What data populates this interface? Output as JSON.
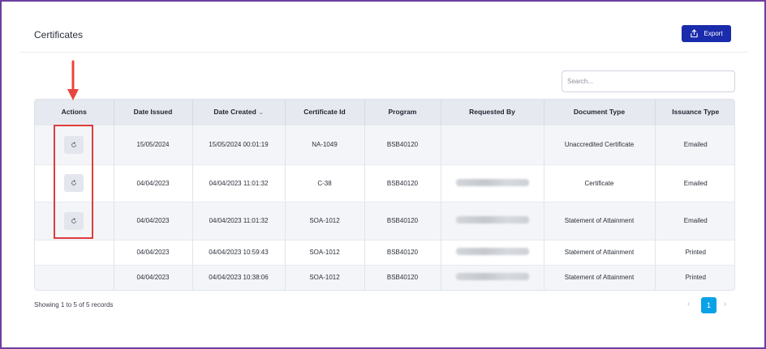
{
  "page": {
    "title": "Certificates",
    "export_label": "Export",
    "search_placeholder": "Search..."
  },
  "table": {
    "columns": [
      "Actions",
      "Date Issued",
      "Date Created",
      "Certificate Id",
      "Program",
      "Requested By",
      "Document Type",
      "Issuance Type"
    ],
    "rows": [
      {
        "date_issued": "15/05/2024",
        "date_created": "15/05/2024 00:01:19",
        "certificate_id": "NA-1049",
        "program": "BSB40120",
        "requested_by": "",
        "document_type": "Unaccredited Certificate",
        "issuance_type": "Emailed"
      },
      {
        "date_issued": "04/04/2023",
        "date_created": "04/04/2023 11:01:32",
        "certificate_id": "C-38",
        "program": "BSB40120",
        "requested_by": "",
        "document_type": "Certificate",
        "issuance_type": "Emailed"
      },
      {
        "date_issued": "04/04/2023",
        "date_created": "04/04/2023 11:01:32",
        "certificate_id": "SOA-1012",
        "program": "BSB40120",
        "requested_by": "",
        "document_type": "Statement of Attainment",
        "issuance_type": "Emailed"
      },
      {
        "date_issued": "04/04/2023",
        "date_created": "04/04/2023 10:59:43",
        "certificate_id": "SOA-1012",
        "program": "BSB40120",
        "requested_by": "",
        "document_type": "Statement of Attainment",
        "issuance_type": "Printed"
      },
      {
        "date_issued": "04/04/2023",
        "date_created": "04/04/2023 10:38:06",
        "certificate_id": "SOA-1012",
        "program": "BSB40120",
        "requested_by": "",
        "document_type": "Statement of Attainment",
        "issuance_type": "Printed"
      }
    ]
  },
  "footer": {
    "records_text": "Showing 1 to 5 of 5 records",
    "current_page": "1",
    "prev_icon": "‹",
    "next_icon": "›"
  },
  "colors": {
    "export_button": "#1a2bab",
    "page_active": "#0aa2e6",
    "highlight": "#e03b3b",
    "frame_border": "#6b3fa0"
  }
}
